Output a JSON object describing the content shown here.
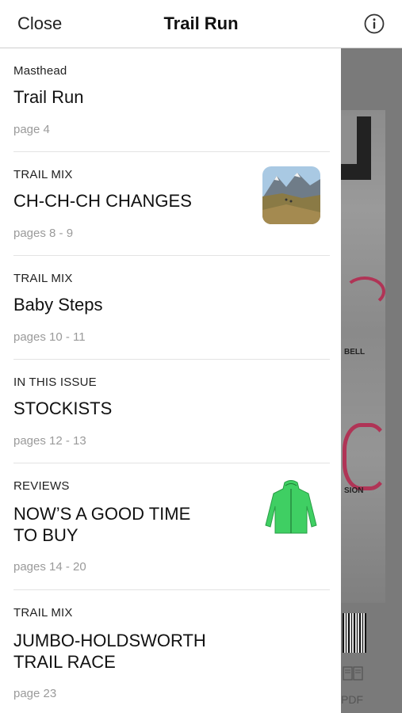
{
  "header": {
    "close_label": "Close",
    "title": "Trail Run"
  },
  "background": {
    "pdf_label": "PDF"
  },
  "entries": [
    {
      "section": "Masthead",
      "headline": "Trail Run",
      "pages": "page 4"
    },
    {
      "section": "TRAIL MIX",
      "headline": "CH-CH-CH CHANGES",
      "pages": "pages 8  -  9"
    },
    {
      "section": "TRAIL MIX",
      "headline": "Baby Steps",
      "pages": "pages 10  -  11"
    },
    {
      "section": "IN THIS ISSUE",
      "headline": "STOCKISTS",
      "pages": "pages 12  -  13"
    },
    {
      "section": "REVIEWS",
      "headline_line1": "NOW’S A GOOD TIME",
      "headline_line2": "TO BUY",
      "pages": "pages 14  -  20"
    },
    {
      "section": "TRAIL MIX",
      "headline_line1": "JUMBO-HOLDSWORTH",
      "headline_line2": "TRAIL RACE",
      "pages": "page 23"
    }
  ]
}
